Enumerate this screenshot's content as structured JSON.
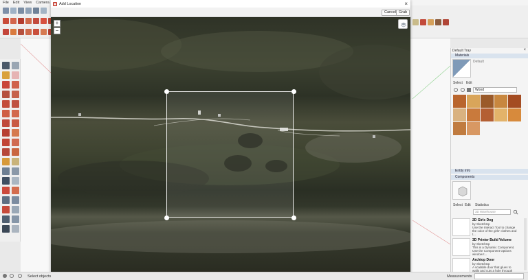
{
  "menu": [
    "File",
    "Edit",
    "View",
    "Camera",
    "Dr"
  ],
  "dialog": {
    "title": "Add Location",
    "close": "×",
    "cancel": "Cancel",
    "grab": "Grab",
    "zoom_in": "+",
    "zoom_out": "−"
  },
  "tray": {
    "title": "Default Tray",
    "materials": {
      "header": "Materials",
      "current": "Default",
      "tabs": [
        "Select",
        "Edit"
      ],
      "collection": "Wood",
      "swatch_colors": [
        "#b9652d",
        "#d9a55a",
        "#9a5a2a",
        "#c8873f",
        "#a44c22",
        "#d9b280",
        "#c97a3c",
        "#b45f33",
        "#e3b36a",
        "#d78a3c",
        "#c07b3f",
        "#d89863"
      ]
    },
    "entity_info": "Entity Info",
    "components": {
      "header": "Components",
      "tabs": [
        "Select",
        "Edit",
        "Statistics"
      ],
      "search_placeholder": "3D Warehouse",
      "items": [
        {
          "title": "2D Girls Dog",
          "by": "by SketchUp",
          "desc": "Use the Interact Tool to change the color of the girls' clothes and t..."
        },
        {
          "title": "3D Printer Build Volume",
          "by": "by SketchUp",
          "desc": "This is a Dynamic Component. Use the Component Options window t..."
        },
        {
          "title": "Archtop Door",
          "by": "by SketchUp",
          "desc": "A scalable door that glues to walls and cuts a hole through them..."
        }
      ]
    }
  },
  "status": {
    "hint": "Select objects",
    "measurements": "Measurements"
  },
  "colors": {
    "accent_blue": "#2a6fdb",
    "tray_header": "#d9e3ee"
  }
}
